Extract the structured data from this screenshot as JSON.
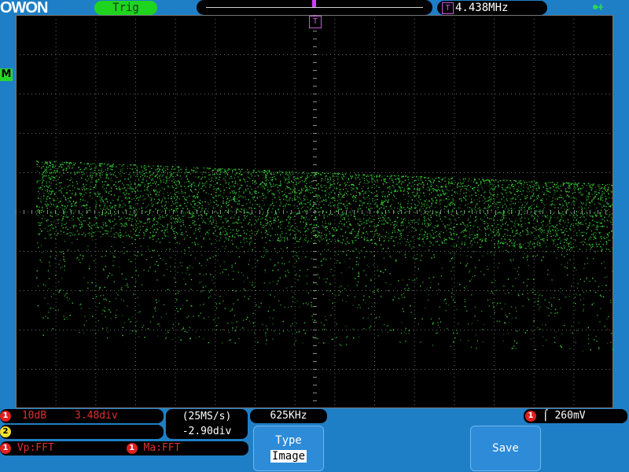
{
  "brand": {
    "logo_text": "OWON"
  },
  "top_bar": {
    "trigger_state": "Trig",
    "trigger_frequency": "4.438MHz",
    "trigger_icon": "T",
    "usb_icon": "usb-icon"
  },
  "screen": {
    "trigger_marker": "T",
    "math_marker": "M",
    "trace_color": "#39d739"
  },
  "status": {
    "ch1_index": "1",
    "ch1_scale": "10dB",
    "ch1_offset": "3.48div",
    "ch2_index": "2",
    "sample_rate": "(25MS/s)",
    "time_offset": "-2.90div",
    "fft_freq": "625KHz",
    "trigger_channel": "1",
    "trigger_level": "260mV",
    "fft_source_index": "1",
    "fft_source": "Vp:FFT",
    "fft_mode_index": "1",
    "fft_mode": "Ma:FFT"
  },
  "softkeys": {
    "type_label": "Type",
    "type_value": "Image",
    "save_label": "Save"
  },
  "colors": {
    "frame_blue": "#1e7fc6",
    "trig_green": "#1fd41f",
    "trigger_purple": "#c35bd6",
    "ch1_red": "#e03030"
  }
}
